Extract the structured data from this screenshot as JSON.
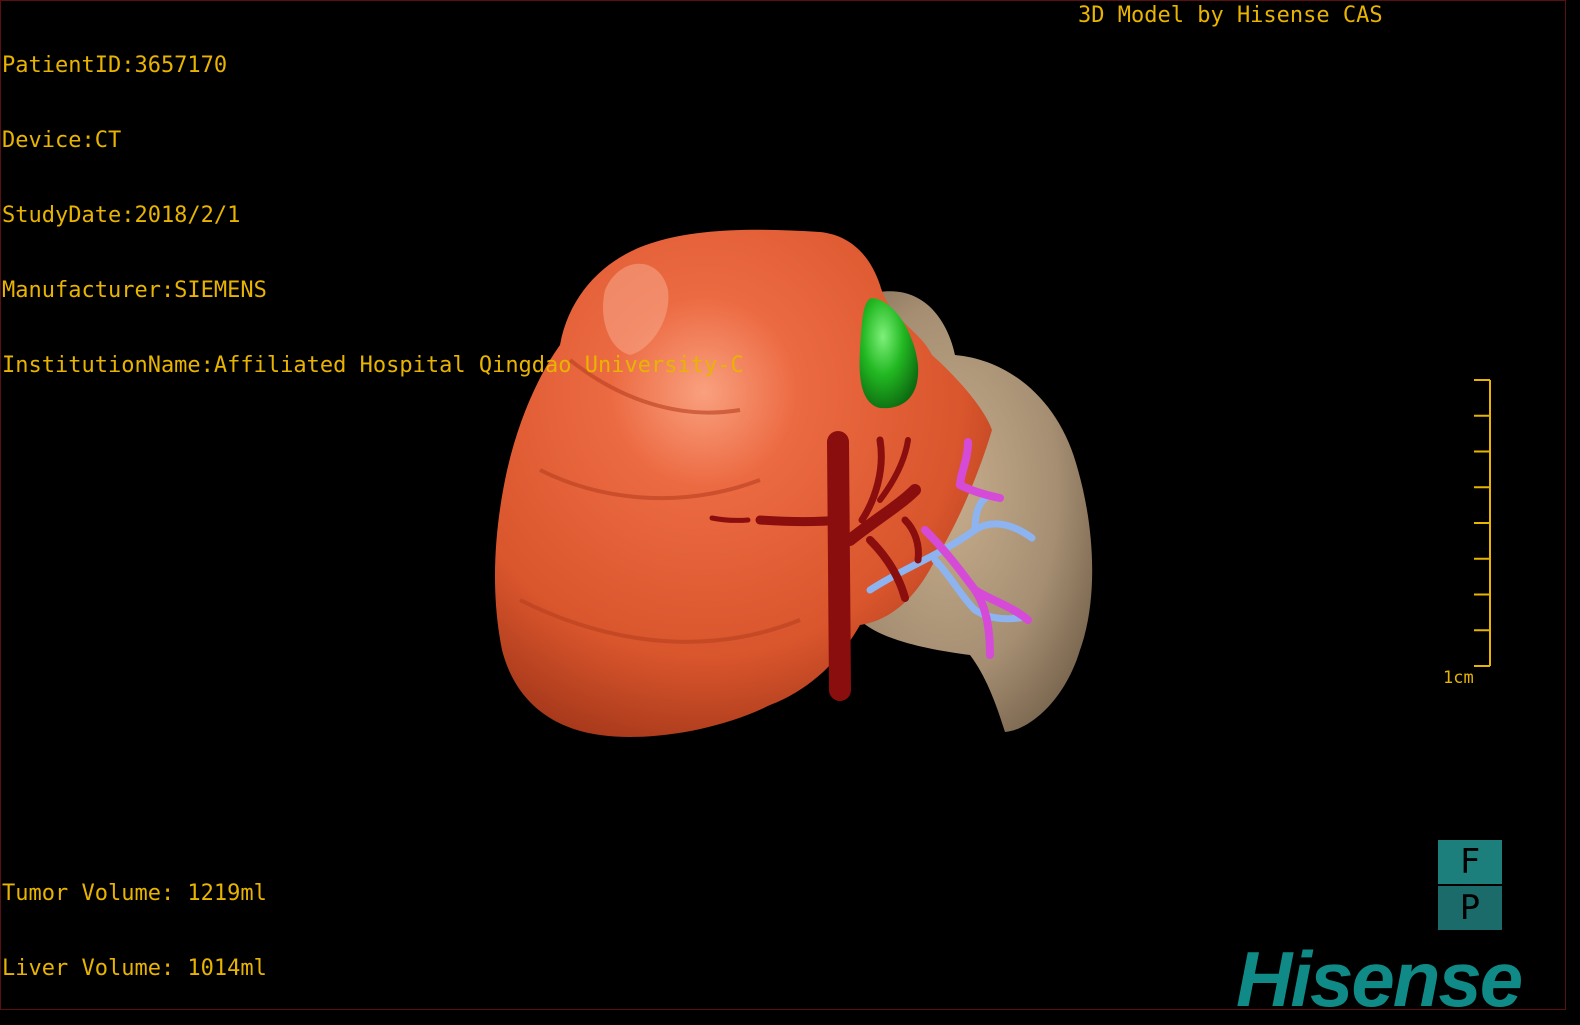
{
  "patient_info": {
    "patient_id": "PatientID:3657170",
    "device": "Device:CT",
    "study_date": "StudyDate:2018/2/1",
    "manufacturer": "Manufacturer:SIEMENS",
    "institution": "InstitutionName:Affiliated Hospital Qingdao University-C"
  },
  "credit": "3D Model by Hisense CAS",
  "volumes": {
    "tumor": "Tumor Volume: 1219ml",
    "liver": "Liver Volume: 1014ml"
  },
  "scale_bar": {
    "label": "1cm",
    "length_cm": 1,
    "minor_ticks": 8
  },
  "orientation_cube": {
    "top_label": "F",
    "bottom_label": "P"
  },
  "brand": "Hisense",
  "colors": {
    "text": "#e8b400",
    "tumor": "#e85a32",
    "liver": "#a58e72",
    "gallbladder": "#22b822",
    "artery": "#8a0e0e",
    "portal_vein": "#d64ad8",
    "hepatic_vein": "#8db4f0",
    "brand": "#0f8a86"
  }
}
